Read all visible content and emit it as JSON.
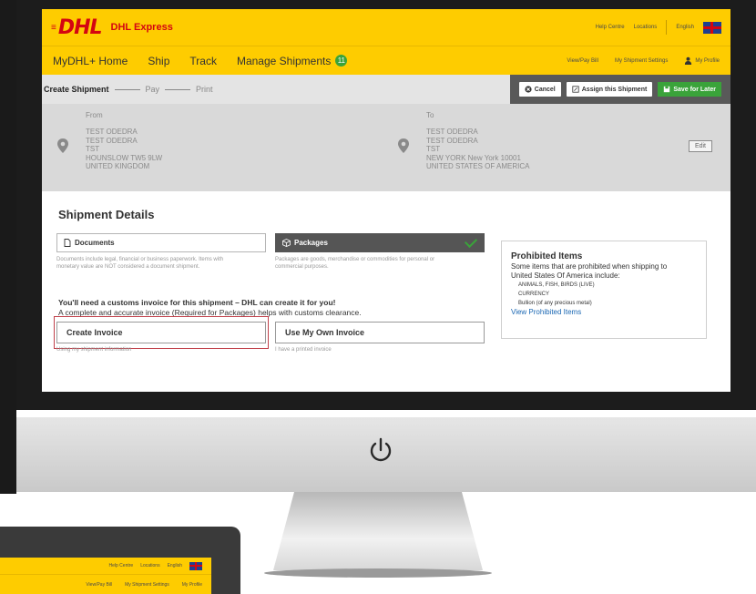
{
  "header": {
    "brand": "DHL",
    "product": "DHL Express",
    "links": [
      "Help Centre",
      "Locations",
      "English"
    ]
  },
  "nav": {
    "items": [
      "MyDHL+ Home",
      "Ship",
      "Track",
      "Manage Shipments"
    ],
    "badge": "11",
    "right_links": [
      "View/Pay Bill",
      "My Shipment Settings",
      "My Profile"
    ]
  },
  "steps": {
    "active": "Create Shipment",
    "pay": "Pay",
    "print": "Print"
  },
  "actions": {
    "cancel": "Cancel",
    "assign": "Assign this Shipment",
    "save": "Save for Later"
  },
  "from": {
    "label": "From",
    "lines": [
      "TEST ODEDRA",
      "TEST ODEDRA",
      "TST",
      "HOUNSLOW TW5 9LW",
      "UNITED KINGDOM"
    ]
  },
  "to": {
    "label": "To",
    "lines": [
      "TEST ODEDRA",
      "TEST ODEDRA",
      "TST",
      "NEW YORK New York 10001",
      "UNITED STATES OF AMERICA"
    ],
    "edit": "Edit"
  },
  "details": {
    "title": "Shipment Details",
    "documents": {
      "label": "Documents",
      "desc1": "Documents include legal, financial or business paperwork. Items with",
      "desc2": "monetary value are NOT considered a document shipment."
    },
    "packages": {
      "label": "Packages",
      "desc1": "Packages are goods, merchandise or commodities for personal or",
      "desc2": "commercial purposes."
    },
    "invoice_msg_bold": "You'll need a customs invoice for this shipment – DHL can create it for you!",
    "invoice_msg": "A complete and accurate invoice (Required for Packages) helps with customs clearance.",
    "create_invoice": "Create Invoice",
    "create_invoice_desc": "Using my shipment information",
    "own_invoice": "Use My Own Invoice",
    "own_invoice_desc": "I have a printed invoice"
  },
  "prohibited": {
    "title": "Prohibited Items",
    "text1": "Some items that are prohibited when shipping to",
    "text2": "United States Of America include:",
    "items": [
      "ANIMALS, FISH, BIRDS (LIVE)",
      "CURRENCY",
      "Bullion (of any precious metal)"
    ],
    "link": "View Prohibited Items"
  },
  "screen2": {
    "links": [
      "Help Centre",
      "Locations",
      "English"
    ],
    "right_links": [
      "View/Pay Bill",
      "My Shipment Settings",
      "My Profile"
    ]
  },
  "colors": {
    "dhl_yellow": "#fecc00",
    "dhl_red": "#d40511",
    "green": "#3aa33a",
    "link_blue": "#1a67b3"
  }
}
